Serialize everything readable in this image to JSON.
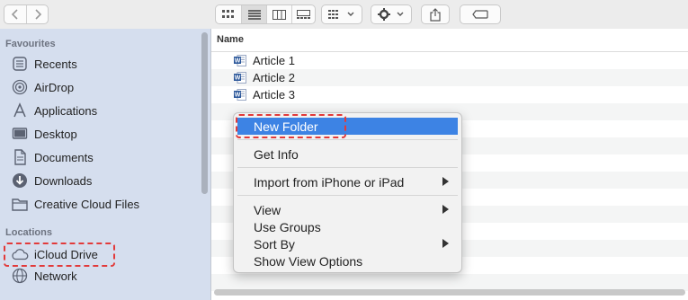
{
  "sidebar": {
    "favourites_heading": "Favourites",
    "favourites": [
      {
        "label": "Recents",
        "icon": "clock-icon"
      },
      {
        "label": "AirDrop",
        "icon": "airdrop-icon"
      },
      {
        "label": "Applications",
        "icon": "applications-icon"
      },
      {
        "label": "Desktop",
        "icon": "desktop-icon"
      },
      {
        "label": "Documents",
        "icon": "document-icon"
      },
      {
        "label": "Downloads",
        "icon": "download-icon"
      },
      {
        "label": "Creative Cloud Files",
        "icon": "folder-icon"
      }
    ],
    "locations_heading": "Locations",
    "locations": [
      {
        "label": "iCloud Drive",
        "icon": "cloud-icon"
      },
      {
        "label": "Network",
        "icon": "globe-icon"
      }
    ]
  },
  "content": {
    "column_name": "Name",
    "files": [
      {
        "name": "Article 1",
        "icon": "word-document-icon"
      },
      {
        "name": "Article 2",
        "icon": "word-document-icon"
      },
      {
        "name": "Article 3",
        "icon": "word-document-icon"
      }
    ]
  },
  "context_menu": {
    "new_folder": "New Folder",
    "get_info": "Get Info",
    "import": "Import from iPhone or iPad",
    "view": "View",
    "use_groups": "Use Groups",
    "sort_by": "Sort By",
    "show_view_options": "Show View Options"
  },
  "colors": {
    "sidebar_bg": "#d5deee",
    "menu_highlight": "#3d83e4",
    "annotation_red": "#e23a3a",
    "word_blue": "#2b579a"
  }
}
